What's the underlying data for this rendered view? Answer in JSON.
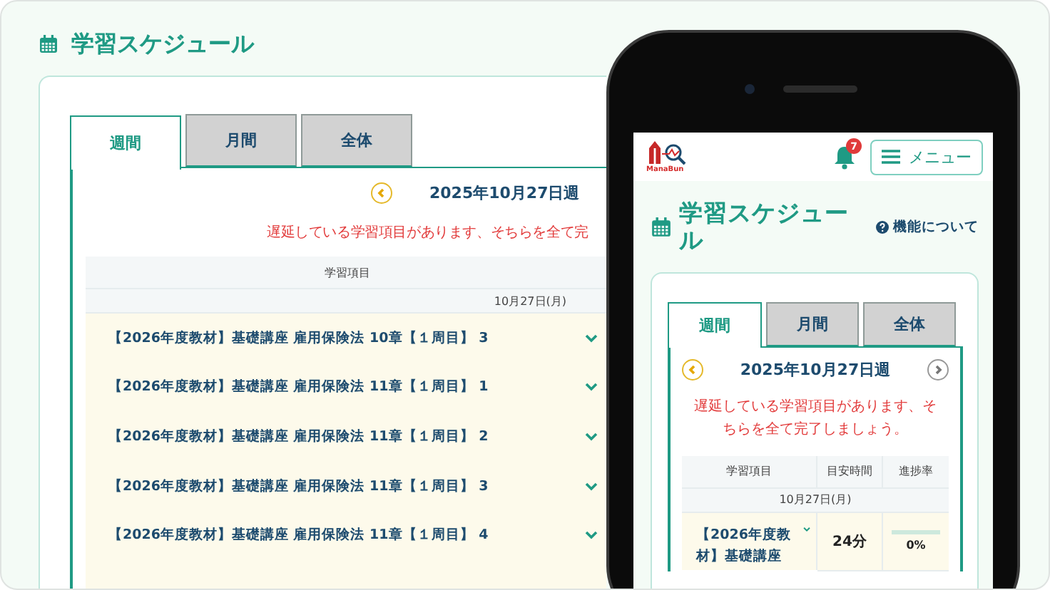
{
  "desktop": {
    "title": "学習スケジュール",
    "tabs": [
      {
        "label": "週間",
        "selected": true
      },
      {
        "label": "月間",
        "selected": false
      },
      {
        "label": "全体",
        "selected": false
      }
    ],
    "week_label": "2025年10月27日週",
    "warning": "遅延している学習項目があります、そちらを全て完",
    "table": {
      "column_header": "学習項目",
      "day": "10月27日(月)",
      "rows": [
        {
          "item": "【2026年度教材】基礎講座 雇用保険法 10章【１周目】 3"
        },
        {
          "item": "【2026年度教材】基礎講座 雇用保険法 11章【１周目】 1"
        },
        {
          "item": "【2026年度教材】基礎講座 雇用保険法 11章【１周目】 2"
        },
        {
          "item": "【2026年度教材】基礎講座 雇用保険法 11章【１周目】 3"
        },
        {
          "item": "【2026年度教材】基礎講座 雇用保険法 11章【１周目】 4"
        }
      ]
    }
  },
  "phone": {
    "logo": "ManaBun",
    "notification_count": "7",
    "menu": "メニュー",
    "title": "学習スケジュール",
    "help": "機能について",
    "tabs": [
      {
        "label": "週間",
        "selected": true
      },
      {
        "label": "月間",
        "selected": false
      },
      {
        "label": "全体",
        "selected": false
      }
    ],
    "week_label": "2025年10月27日週",
    "warning": "遅延している学習項目があります、そちらを全て完了しましょう。",
    "table": {
      "columns": [
        "学習項目",
        "目安時間",
        "進捗率"
      ],
      "day": "10月27日(月)",
      "rows": [
        {
          "item": "【2026年度教材】基礎講座",
          "time": "24分",
          "progress": "0%",
          "level": 0
        }
      ]
    }
  }
}
